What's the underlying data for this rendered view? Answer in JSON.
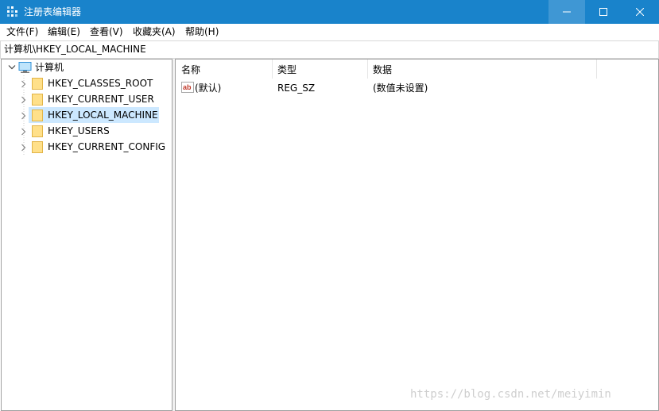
{
  "window": {
    "title": "注册表编辑器",
    "accent_color": "#1983cb",
    "controls": [
      "minimize-icon",
      "maximize-icon",
      "close-icon"
    ]
  },
  "menu": {
    "items": [
      {
        "label": "文件(F)"
      },
      {
        "label": "编辑(E)"
      },
      {
        "label": "查看(V)"
      },
      {
        "label": "收藏夹(A)"
      },
      {
        "label": "帮助(H)"
      }
    ]
  },
  "address": {
    "value": "计算机\\HKEY_LOCAL_MACHINE"
  },
  "tree": {
    "root": {
      "label": "计算机",
      "icon": "computer-icon",
      "expanded": true
    },
    "items": [
      {
        "label": "HKEY_CLASSES_ROOT",
        "icon": "folder-icon",
        "selected": false
      },
      {
        "label": "HKEY_CURRENT_USER",
        "icon": "folder-icon",
        "selected": false
      },
      {
        "label": "HKEY_LOCAL_MACHINE",
        "icon": "folder-icon",
        "selected": true
      },
      {
        "label": "HKEY_USERS",
        "icon": "folder-icon",
        "selected": false
      },
      {
        "label": "HKEY_CURRENT_CONFIG",
        "icon": "folder-icon",
        "selected": false
      }
    ],
    "selection_color": "#cce8ff"
  },
  "list": {
    "columns": [
      "名称",
      "类型",
      "数据"
    ],
    "rows": [
      {
        "icon": "string-value-icon",
        "name": "(默认)",
        "type": "REG_SZ",
        "data": "(数值未设置)"
      }
    ]
  },
  "watermark": "https://blog.csdn.net/meiyimin"
}
